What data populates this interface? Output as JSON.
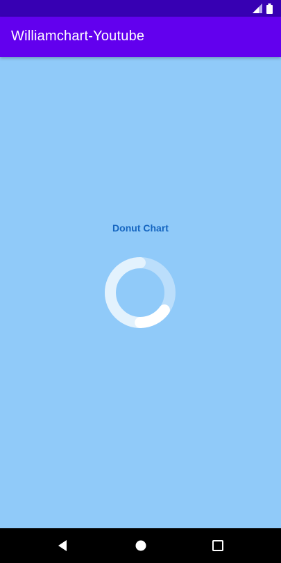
{
  "app": {
    "title": "Williamchart-Youtube"
  },
  "chart": {
    "title": "Donut Chart"
  },
  "chart_data": {
    "type": "pie",
    "title": "Donut Chart",
    "series": [
      {
        "values": [
          50,
          15
        ]
      }
    ],
    "total": 100,
    "colors": {
      "background_ring": "#BBDEFB",
      "track": "#E3F2FD",
      "segment": "#FFFFFF"
    }
  },
  "icons": {
    "status": [
      "signal-icon",
      "battery-icon"
    ],
    "nav": [
      "back-icon",
      "home-icon",
      "recents-icon"
    ]
  },
  "colors": {
    "status_bar": "#3700B3",
    "app_bar": "#6200EE",
    "background": "#90CAF9",
    "chart_title": "#1565C0",
    "nav_bar": "#000000"
  }
}
